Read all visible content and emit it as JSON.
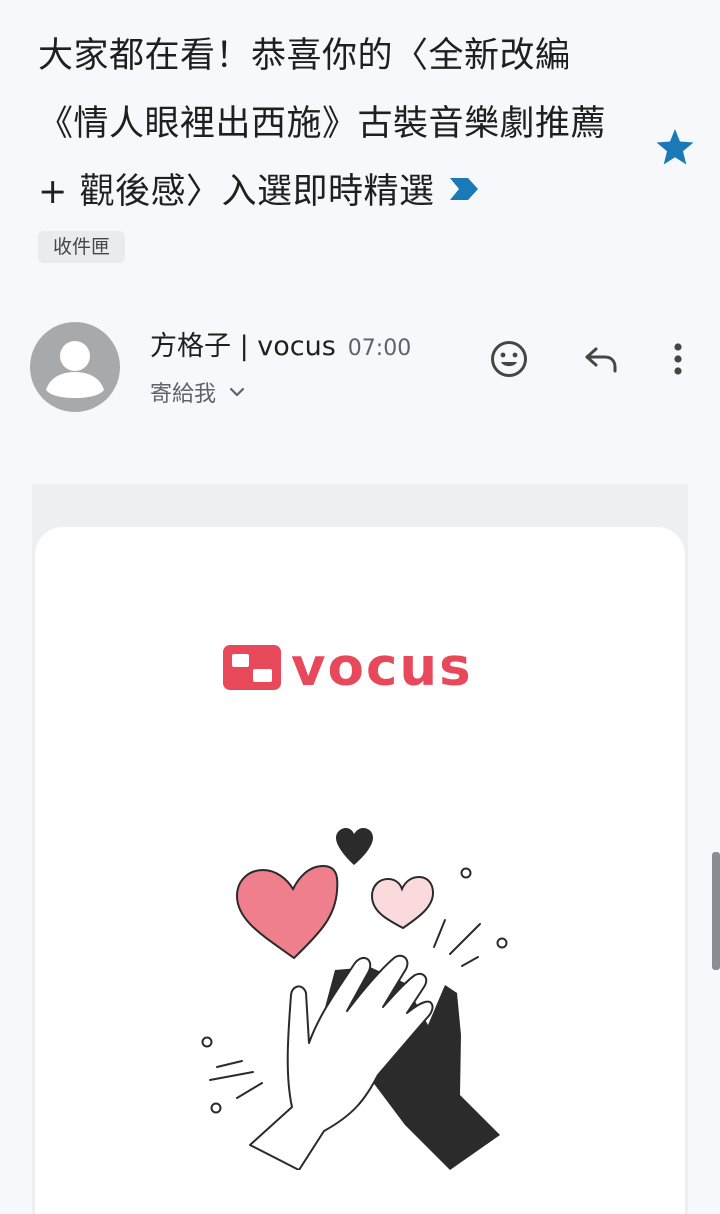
{
  "email": {
    "subject": "大家都在看！恭喜你的〈全新改編《情人眼裡出西施》古裝音樂劇推薦 + 觀後感〉入選即時精選",
    "label": "收件匣",
    "sender": "方格子 | vocus",
    "time": "07:00",
    "recipient": "寄給我"
  },
  "body": {
    "brand_name": "vocus"
  },
  "icons": {
    "importance": "importance-marker-icon",
    "star": "star-icon",
    "emoji": "add-reaction-icon",
    "reply": "reply-icon",
    "more": "more-vert-icon",
    "chevron": "chevron-down-icon"
  },
  "colors": {
    "accent_blue": "#1a73e8",
    "star_blue": "#1a7ab8",
    "brand_red": "#e8495a",
    "avatar_gray": "#a7aaad"
  }
}
